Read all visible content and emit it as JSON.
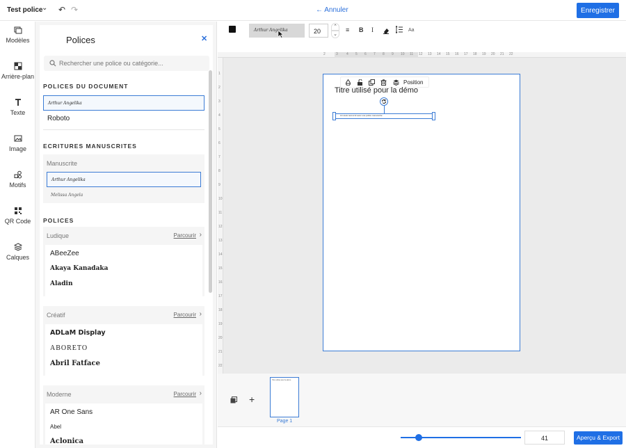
{
  "topbar": {
    "document_title": "Test police",
    "cancel_label": "Annuler",
    "save_label": "Enregistrer"
  },
  "rail": {
    "items": [
      {
        "label": "Modèles",
        "icon": "templates-icon"
      },
      {
        "label": "Arrière-plan",
        "icon": "background-icon"
      },
      {
        "label": "Texte",
        "icon": "text-icon"
      },
      {
        "label": "Image",
        "icon": "image-icon"
      },
      {
        "label": "Motifs",
        "icon": "shapes-icon"
      },
      {
        "label": "QR Code",
        "icon": "qrcode-icon"
      },
      {
        "label": "Calques",
        "icon": "layers-icon"
      }
    ]
  },
  "panel": {
    "title": "Polices",
    "search_placeholder": "Rechercher une police ou catégorie...",
    "document_fonts_heading": "POLICES DU DOCUMENT",
    "document_fonts": [
      "Arthur Angelika",
      "Roboto"
    ],
    "handwriting_heading": "ECRITURES MANUSCRITES",
    "handwriting_card_title": "Manuscrite",
    "handwriting_fonts": [
      "Arthur Angelika",
      "Melissa Angela"
    ],
    "fonts_heading": "POLICES",
    "browse_label": "Parcourir",
    "categories": [
      {
        "name": "Ludique",
        "fonts": [
          "ABeeZee",
          "Akaya Kanadaka",
          "Aladin"
        ]
      },
      {
        "name": "Créatif",
        "fonts": [
          "ADLaM Display",
          "ABORETO",
          "Abril Fatface"
        ]
      },
      {
        "name": "Moderne",
        "fonts": [
          "AR One Sans",
          "Abel",
          "Aclonica"
        ]
      }
    ]
  },
  "text_toolbar": {
    "color": "#111111",
    "font_name": "Arthur Angelika",
    "font_size": "20",
    "bold_label": "B",
    "italic_label": "I",
    "case_label": "Aa"
  },
  "ruler": {
    "top_numbers": [
      "2",
      "3",
      "4",
      "5",
      "6",
      "7",
      "8",
      "9",
      "10",
      "11",
      "12",
      "13",
      "14",
      "15",
      "16",
      "17",
      "18",
      "19",
      "20",
      "21",
      "22"
    ],
    "left_numbers": [
      "1",
      "2",
      "3",
      "4",
      "5",
      "6",
      "7",
      "8",
      "9",
      "10",
      "11",
      "12",
      "13",
      "14",
      "15",
      "16",
      "17",
      "18",
      "19",
      "20",
      "21",
      "22"
    ]
  },
  "page": {
    "title_text": "Titre utilisé pour la démo",
    "selected_text": "Un texte test écrit avec une police manuscrite",
    "position_label": "Position"
  },
  "strip": {
    "page_label": "Page 1"
  },
  "bottom": {
    "zoom_value": "41",
    "zoom_fraction": 0.15,
    "export_label": "Aperçu & Export"
  },
  "colors": {
    "accent": "#1f6fe5",
    "selection": "#3a7bd5"
  }
}
